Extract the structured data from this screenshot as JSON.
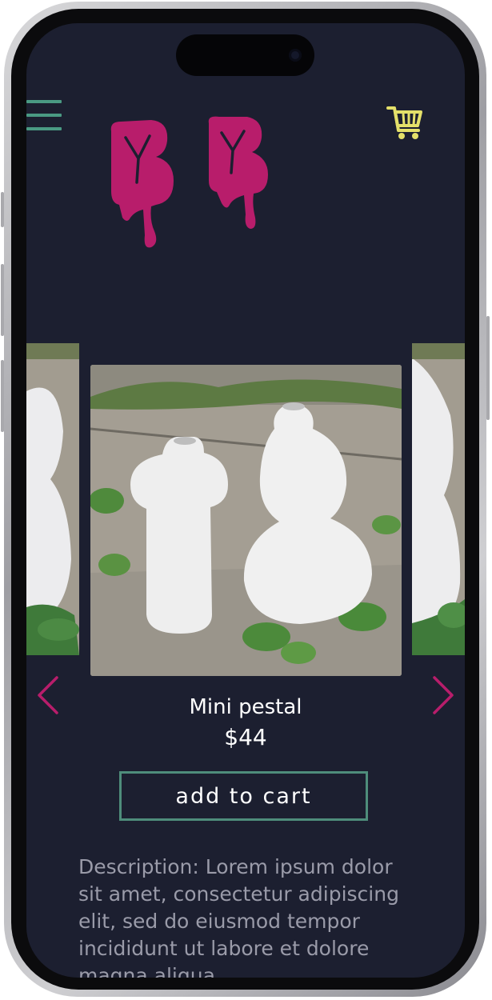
{
  "header": {
    "menu_icon": "hamburger-menu-icon",
    "cart_icon": "shopping-cart-icon",
    "logo_text": "BB",
    "colors": {
      "accent": "#4a9a83",
      "cart": "#e4e06a",
      "logo": "#b81d6b",
      "background": "#1c1f30"
    }
  },
  "carousel": {
    "prev_icon": "chevron-left-icon",
    "next_icon": "chevron-right-icon",
    "arrow_color": "#b81d6b"
  },
  "product": {
    "name": "Mini pestal",
    "price": "$44"
  },
  "actions": {
    "add_to_cart_label": "add to cart"
  },
  "description": {
    "text": "Description: Lorem ipsum dolor sit amet, consectetur adipiscing elit, sed do eiusmod tempor incididunt ut labore et dolore magna aliqua."
  }
}
